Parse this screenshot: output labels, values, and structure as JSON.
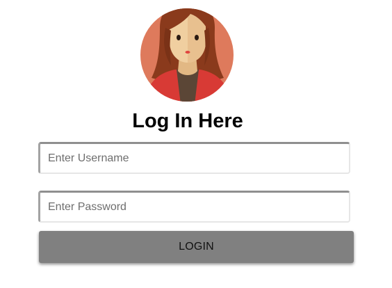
{
  "avatar": {
    "icon": "woman-avatar-icon",
    "colors": {
      "background": "#de7a5c",
      "hair": "#8a3a1c",
      "skin": "#f0cfa0",
      "jacket": "#d83a35",
      "shirt": "#5b4636"
    }
  },
  "form": {
    "title": "Log In Here",
    "username_placeholder": "Enter Username",
    "password_placeholder": "Enter Password",
    "login_label": "LOGIN"
  },
  "colors": {
    "button_bg": "#808080",
    "field_border": "#a3a3a3"
  }
}
